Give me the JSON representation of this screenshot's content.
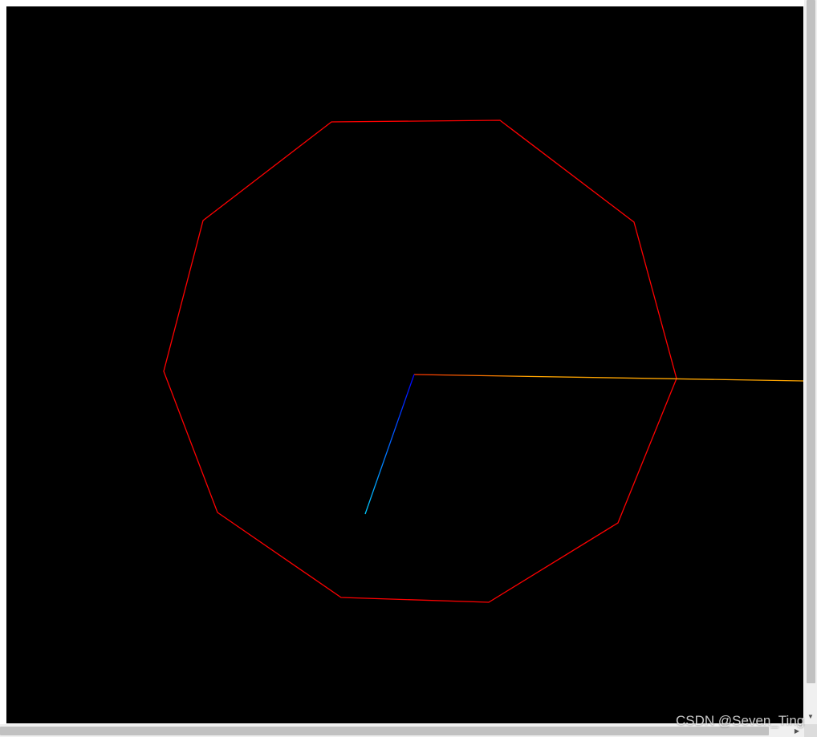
{
  "scene": {
    "background_color": "#000000",
    "axes": {
      "x_axis_color": "#ffa500",
      "y_axis_color_base": "#00ff00",
      "y_axis_color_tip": "#ffff00",
      "z_axis_color_base": "#0000ff",
      "z_axis_color_tip": "#00ccff"
    },
    "shape": {
      "type": "decagon-outline",
      "vertex_count": 10,
      "color": "#ff0000"
    }
  },
  "scrollbars": {
    "vertical_down_glyph": "▼",
    "horizontal_right_glyph": "▶"
  },
  "watermark": {
    "text": "CSDN @Seven_Ting"
  }
}
